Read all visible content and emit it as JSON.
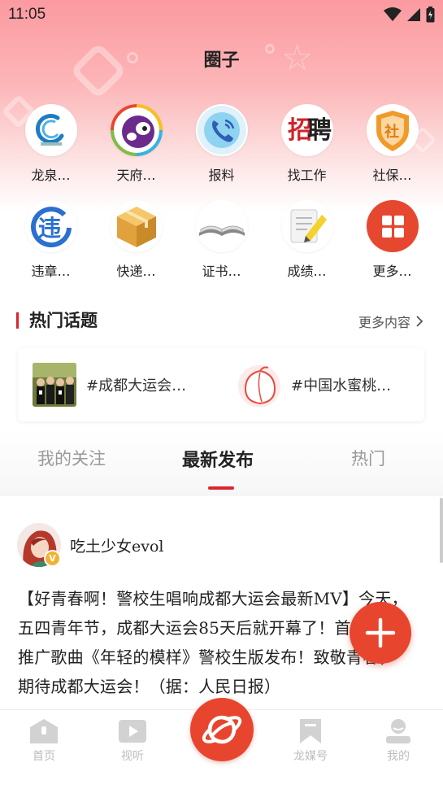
{
  "status_bar": {
    "time": "11:05"
  },
  "page": {
    "title": "圈子"
  },
  "grid": [
    {
      "label": "龙泉…",
      "icon": "longquan-logo-icon"
    },
    {
      "label": "天府…",
      "icon": "tianfu-panda-icon"
    },
    {
      "label": "报料",
      "icon": "phone-icon"
    },
    {
      "label": "找工作",
      "icon": "recruit-icon"
    },
    {
      "label": "社保…",
      "icon": "social-security-shield-icon"
    },
    {
      "label": "违章…",
      "icon": "traffic-violation-icon"
    },
    {
      "label": "快递…",
      "icon": "package-box-icon"
    },
    {
      "label": "证书…",
      "icon": "open-book-icon"
    },
    {
      "label": "成绩…",
      "icon": "notepad-pencil-icon"
    },
    {
      "label": "更多…",
      "icon": "grid-more-icon"
    }
  ],
  "hot_topics": {
    "title": "热门话题",
    "more": "更多内容",
    "items": [
      {
        "text": "#成都大运会…",
        "thumb": "group-photo-thumbnail"
      },
      {
        "text": "#中国水蜜桃…",
        "thumb": "peach-icon"
      }
    ]
  },
  "tabs": [
    {
      "label": "我的关注",
      "active": false
    },
    {
      "label": "最新发布",
      "active": true
    },
    {
      "label": "热门",
      "active": false
    }
  ],
  "post": {
    "author": "吃土少女evol",
    "badge": "V",
    "lines": [
      "【好青春啊！警校生唱响成都大运会最新MV】今天，",
      "五四青年节，成都大运会85天后就开幕了！首",
      "推广歌曲《年轻的模样》警校生版发布！致敬青春，",
      "期待成都大运会！（据：人民日报）"
    ]
  },
  "bottom_nav": {
    "home": "首页",
    "video": "视听",
    "media": "龙媒号",
    "me": "我的"
  },
  "colors": {
    "accent": "#d8262d",
    "fab": "#e8452f",
    "header_top": "#fb9aa0"
  }
}
